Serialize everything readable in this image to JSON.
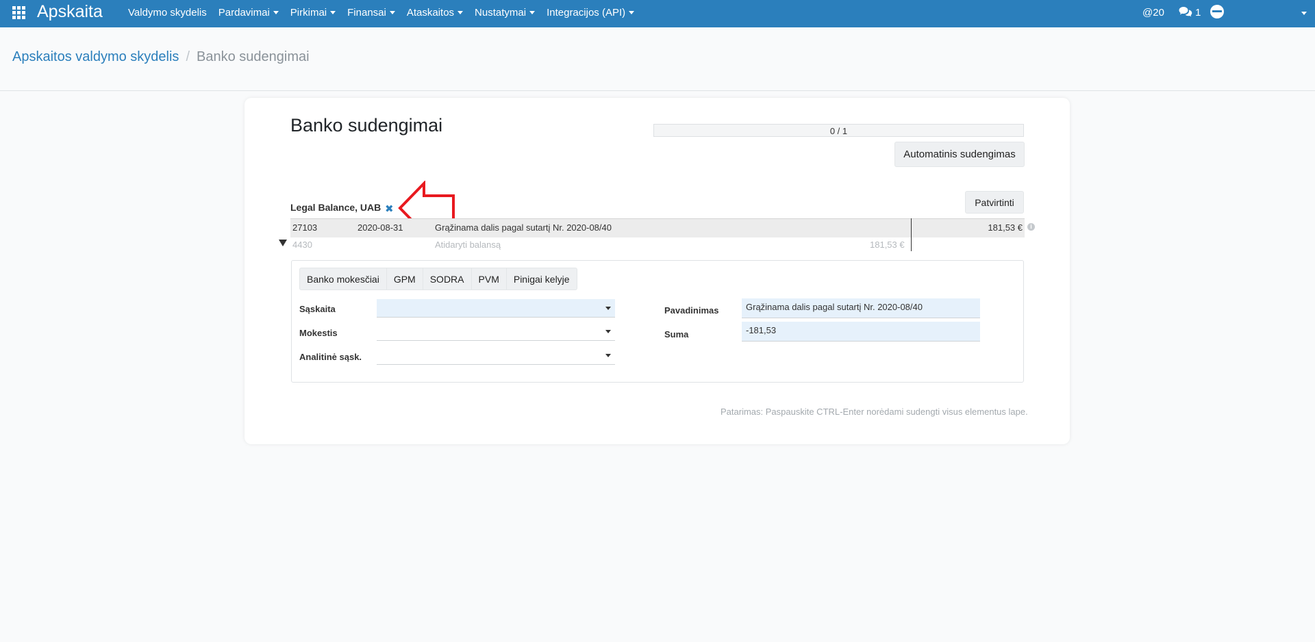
{
  "navbar": {
    "brand": "Apskaita",
    "menu": [
      {
        "label": "Valdymo skydelis",
        "dropdown": false
      },
      {
        "label": "Pardavimai",
        "dropdown": true
      },
      {
        "label": "Pirkimai",
        "dropdown": true
      },
      {
        "label": "Finansai",
        "dropdown": true
      },
      {
        "label": "Ataskaitos",
        "dropdown": true
      },
      {
        "label": "Nustatymai",
        "dropdown": true
      },
      {
        "label": "Integracijos (API)",
        "dropdown": true
      }
    ],
    "mentions": "@20",
    "messages_count": "1",
    "color": "#2b7fbc"
  },
  "breadcrumb": {
    "parent": "Apskaitos valdymo skydelis",
    "separator": "/",
    "current": "Banko sudengimai"
  },
  "page": {
    "title": "Banko sudengimai",
    "progress_text": "0 / 1",
    "auto_button": "Automatinis sudengimas",
    "confirm_button": "Patvirtinti"
  },
  "entry": {
    "partner": "Legal Balance, UAB",
    "remove_symbol": "✖",
    "main_row": {
      "number": "27103",
      "date": "2020-08-31",
      "description": "Grąžinama dalis pagal sutartį Nr. 2020-08/40",
      "amount": "181,53 €"
    },
    "sub_row": {
      "account": "4430",
      "description": "Atidaryti balansą",
      "amount": "181,53 €"
    }
  },
  "tabs": [
    "Banko mokesčiai",
    "GPM",
    "SODRA",
    "PVM",
    "Pinigai kelyje"
  ],
  "form": {
    "saskaita_label": "Sąskaita",
    "mokestis_label": "Mokestis",
    "analitine_label": "Analitinė sąsk.",
    "pavadinimas_label": "Pavadinimas",
    "pavadinimas_value": "Grąžinama dalis pagal sutartį Nr. 2020-08/40",
    "suma_label": "Suma",
    "suma_value": "-181,53"
  },
  "hint": "Patarimas: Paspauskite CTRL-Enter norėdami sudengti visus elementus lape.",
  "annotation_color": "#e8191f"
}
